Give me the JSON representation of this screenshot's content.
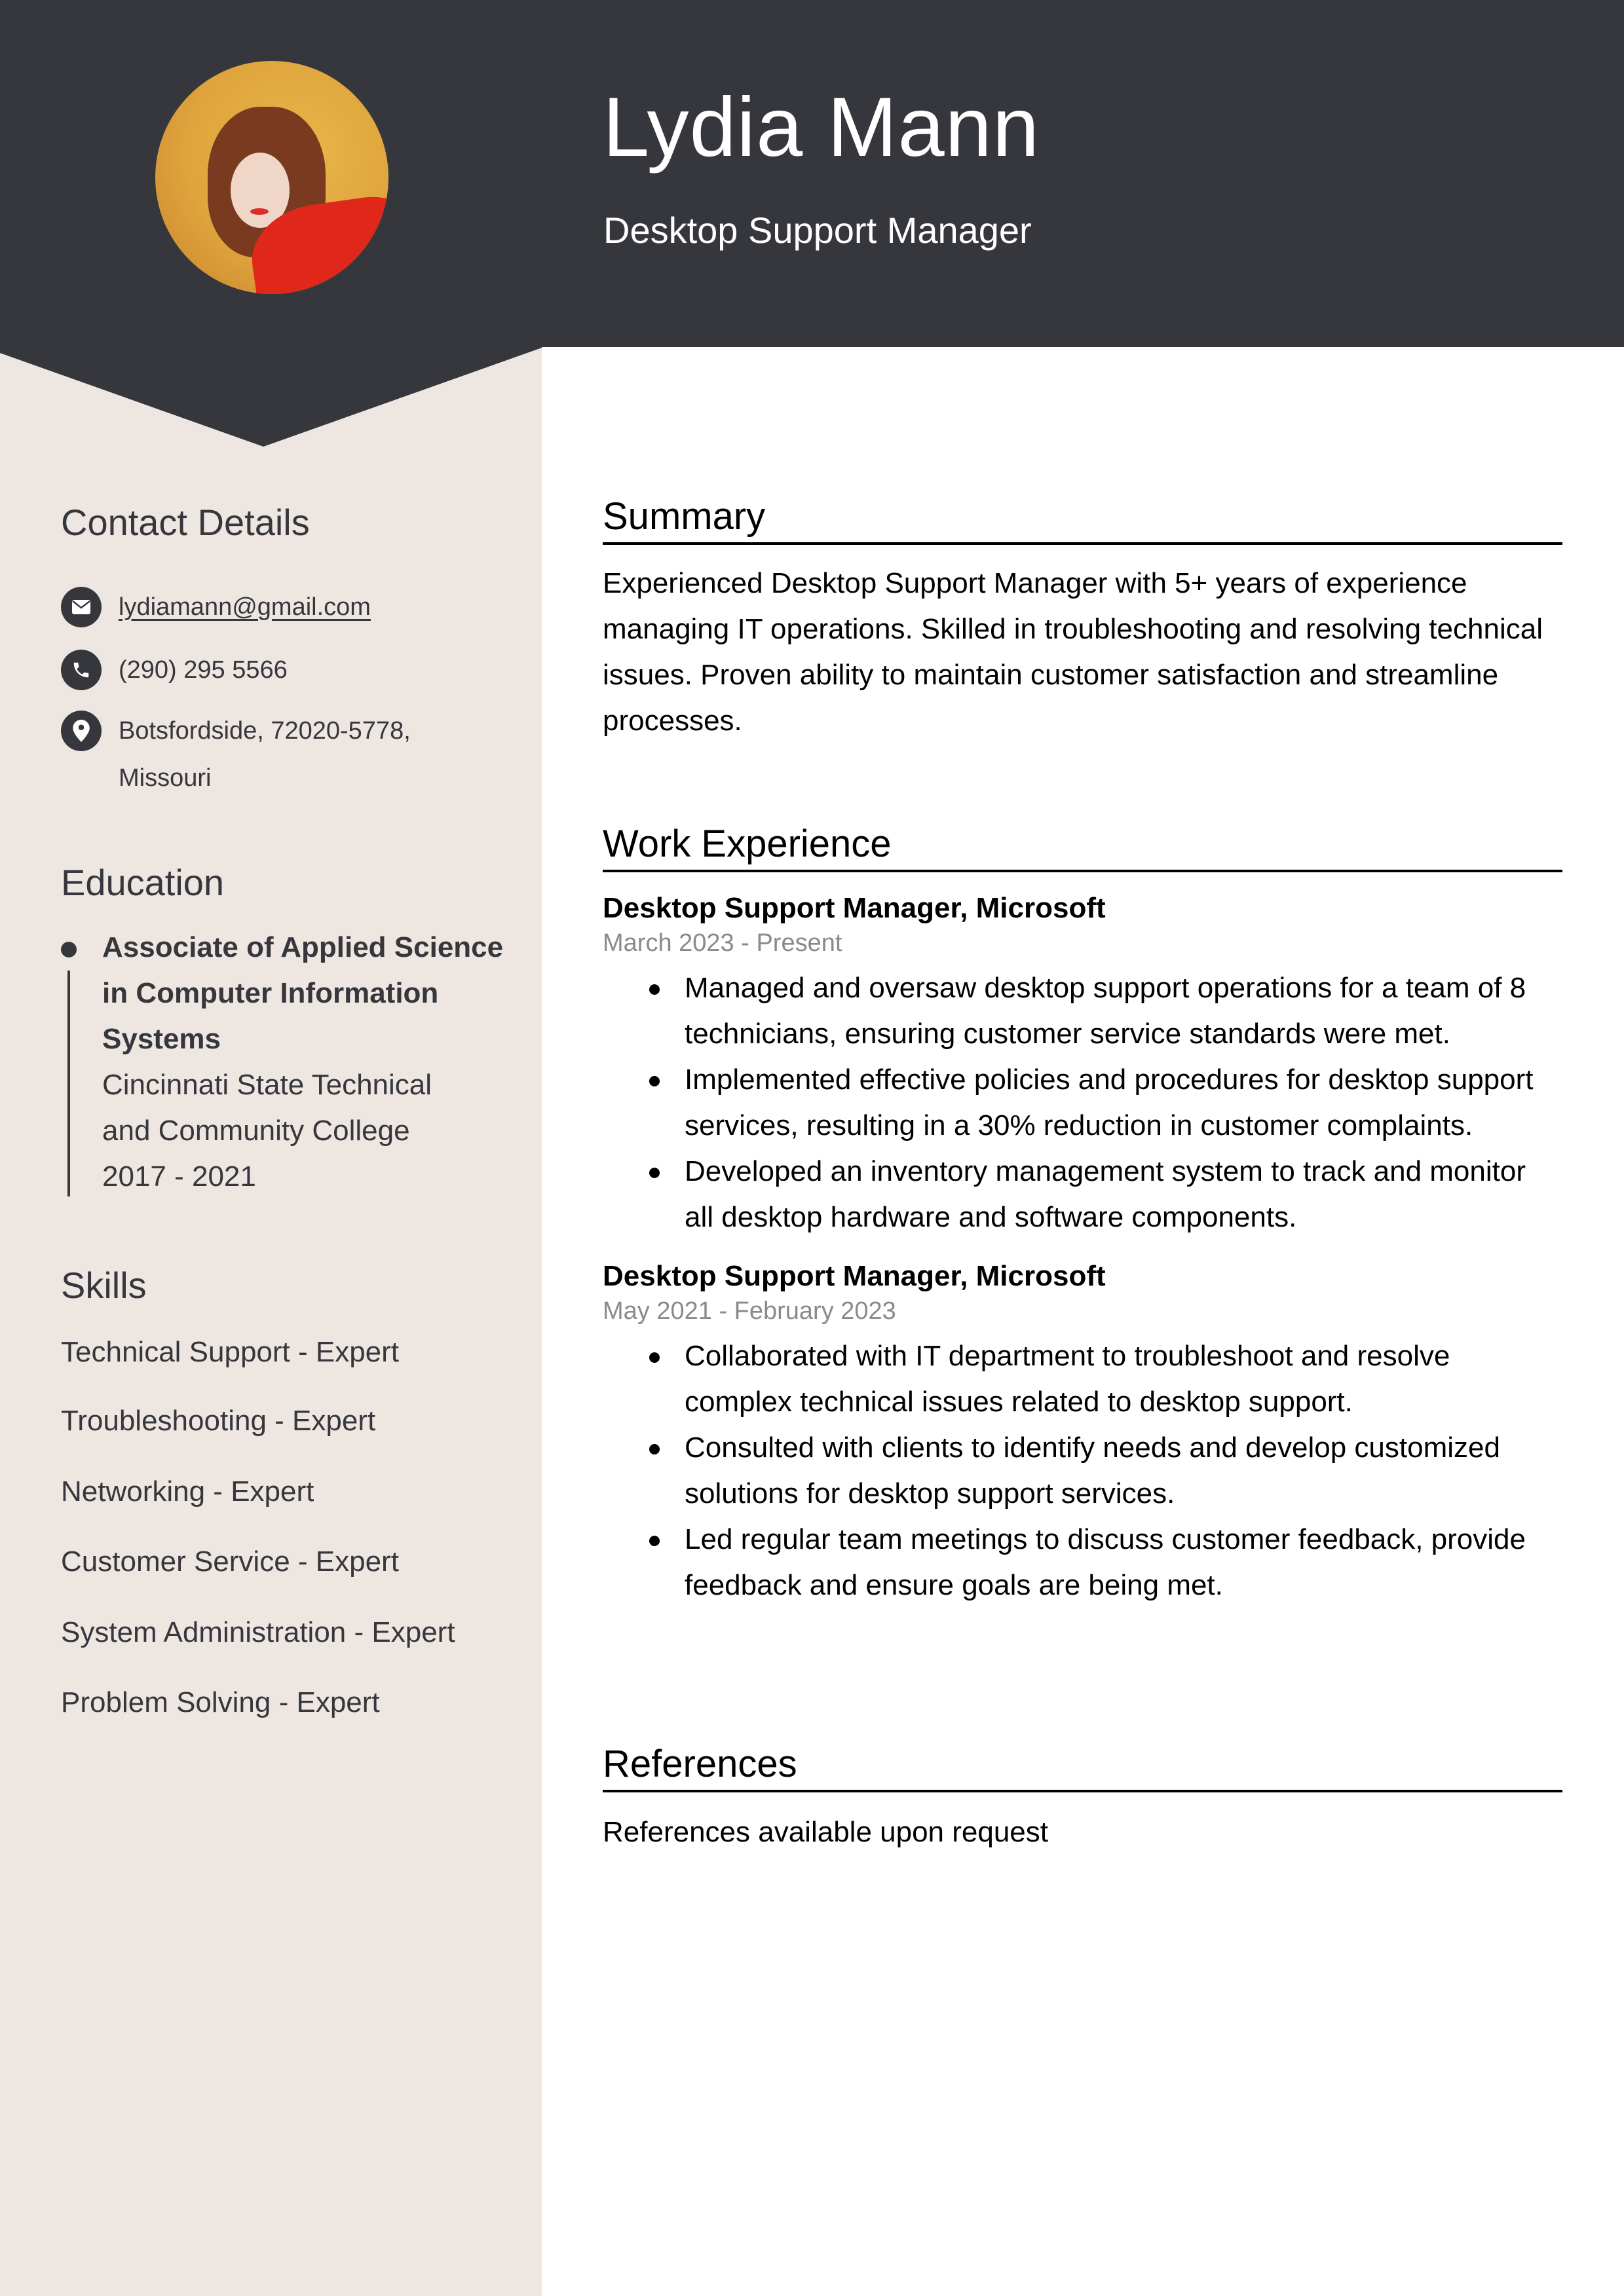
{
  "header": {
    "name": "Lydia Mann",
    "title": "Desktop Support Manager",
    "photo_alt": "profile-photo"
  },
  "colors": {
    "header_bg": "#36373d",
    "sidebar_bg": "#ede6e1",
    "main_bg": "#ffffff",
    "date_gray": "#8a8a8a"
  },
  "sidebar": {
    "contact": {
      "heading": "Contact Details",
      "email": "lydiamann@gmail.com",
      "phone": "(290) 295 5566",
      "address_line1": "Botsfordside, 72020-5778,",
      "address_line2": "Missouri",
      "icons": [
        "envelope-icon",
        "phone-icon",
        "location-pin-icon"
      ]
    },
    "education": {
      "heading": "Education",
      "degree_line1": "Associate of Applied Science",
      "degree_line2": "in Computer Information",
      "degree_line3": "Systems",
      "school_line1": "Cincinnati State Technical",
      "school_line2": "and Community College",
      "years": "2017 - 2021"
    },
    "skills": {
      "heading": "Skills",
      "items": [
        "Technical Support - Expert",
        "Troubleshooting - Expert",
        "Networking - Expert",
        "Customer Service - Expert",
        "System Administration - Expert",
        "Problem Solving - Expert"
      ]
    }
  },
  "main": {
    "summary": {
      "heading": "Summary",
      "text": "Experienced Desktop Support Manager with 5+ years of experience managing IT operations. Skilled in troubleshooting and resolving technical issues. Proven ability to maintain customer satisfaction and streamline processes."
    },
    "work": {
      "heading": "Work Experience",
      "jobs": [
        {
          "title": "Desktop Support Manager, Microsoft",
          "dates": "March 2023 - Present",
          "bullets": [
            "Managed and oversaw desktop support operations for a team of 8 technicians, ensuring customer service standards were met.",
            "Implemented effective policies and procedures for desktop support services, resulting in a 30% reduction in customer complaints.",
            "Developed an inventory management system to track and monitor all desktop hardware and software components."
          ]
        },
        {
          "title": "Desktop Support Manager, Microsoft",
          "dates": "May 2021 - February 2023",
          "bullets": [
            "Collaborated with IT department to troubleshoot and resolve complex technical issues related to desktop support.",
            "Consulted with clients to identify needs and develop customized solutions for desktop support services.",
            "Led regular team meetings to discuss customer feedback, provide feedback and ensure goals are being met."
          ]
        }
      ]
    },
    "references": {
      "heading": "References",
      "text": "References available upon request"
    }
  }
}
